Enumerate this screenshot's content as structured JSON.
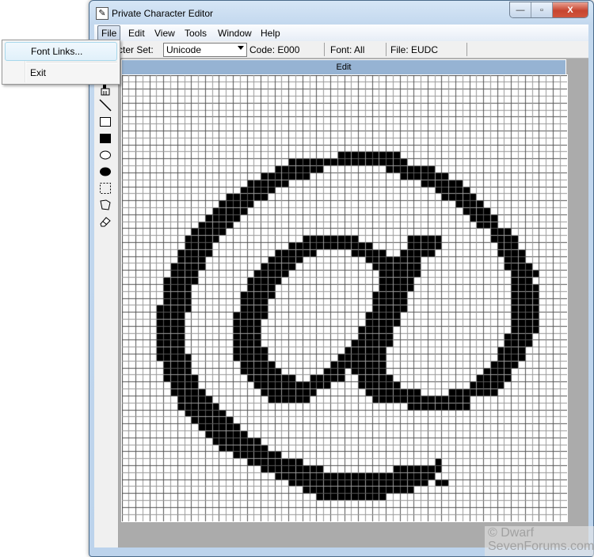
{
  "window": {
    "title": "Private Character Editor",
    "app_icon": "pencil-icon",
    "buttons": {
      "minimize": "—",
      "maximize": "▫",
      "close": "X"
    }
  },
  "menubar": {
    "items": [
      {
        "label": "File",
        "active": true
      },
      {
        "label": "Edit"
      },
      {
        "label": "View"
      },
      {
        "label": "Tools"
      },
      {
        "label": "Window"
      },
      {
        "label": "Help"
      }
    ]
  },
  "file_menu": {
    "items": [
      {
        "label": "Font Links...",
        "hovered": true
      },
      {
        "label": "Exit"
      }
    ]
  },
  "toolbar": {
    "charset_label": "Character Set:",
    "charset_visible_label": "cter Set:",
    "charset_value": "Unicode",
    "code": "Code: E000",
    "font": "Font: All",
    "file": "File: EUDC"
  },
  "tools": [
    {
      "name": "brush-icon",
      "glyph": "🖌"
    },
    {
      "name": "line-icon"
    },
    {
      "name": "hollow-rectangle-icon"
    },
    {
      "name": "filled-rectangle-icon"
    },
    {
      "name": "hollow-ellipse-icon"
    },
    {
      "name": "filled-ellipse-icon"
    },
    {
      "name": "rectangle-select-icon"
    },
    {
      "name": "freeform-select-icon"
    },
    {
      "name": "eraser-icon"
    }
  ],
  "editor": {
    "header": "Edit",
    "grid_size": 64,
    "bitmap": [
      "................................................................",
      "................................................................",
      "................................................................",
      "................................................................",
      "................................................................",
      "................................................................",
      "................................................................",
      "................................................................",
      "................................................................",
      "................................................................",
      "................................................................",
      "...............................#########........................",
      "........................#################.......................",
      "......................#######.........#######...................",
      "....................#######.............#######.................",
      "..................######...................######...............",
      ".................#####.......................#####..............",
      "...............######.........................#####.............",
      "..............#####.............................####............",
      ".............#####...............................####...........",
      "............#####.................................####..........",
      "...........#####...................................###..........",
      "..........#####......................................###.........",
      ".........#####............########.......#####.......####.......",
      ".........####...........############.....#####........###.......",
      "........#####.........######.....#####..#####.........####......",
      "........####.........#####.........########............###......",
      ".......#####........#####...........#######............####.....",
      ".......####........#####.............######.............####.....",
      "......#####.......#####..............#####..............###.....",
      "......####........####...............#####..............####....",
      "......####.......#####..............#####...............####....",
      "......####.......####...............#####...............####....",
      ".....#####.......####...............#####...............####....",
      ".....####.......#####..............#####................####....",
      ".....####.......####...............#####................####....",
      ".....####.......####..............#####.................####....",
      ".....####.......####..............#####................####.....",
      ".....####.......####.............######................####.....",
      ".....####.......#####...........######................####......",
      ".....#####......#####..........#######................####......",
      "......####.......#####........########...............####.......",
      "......####.......######......###.#####..............####........",
      "......#####.......#######..#####..#####............#####........",
      ".......####........###########....######..........#####.........",
      ".......#####........########.......########....#######..........",
      "........#####........######.........##############.............",
      "........######...........................#########..............",
      ".........######.................................................",
      "..........######................................................",
      "...........######...............................................",
      "............######..............................................",
      ".............#######............................................",
      "..............#######...........................................",
      "................#######.........................................",
      "..................########...................#..................",
      "....................#########..........#######..................",
      "......................#######################...................",
      "........................####################.##.................",
      "..........................################......................",
      "............................##########..........................",
      "................................................................",
      "................................................................",
      "................................................................"
    ],
    "colors": {
      "on": "#000000",
      "off": "#ffffff",
      "grid_major": "#555555",
      "grid_minor": "#9a9a9a"
    }
  },
  "watermark": {
    "line1": "© Dwarf",
    "line2": "SevenForums.com"
  }
}
